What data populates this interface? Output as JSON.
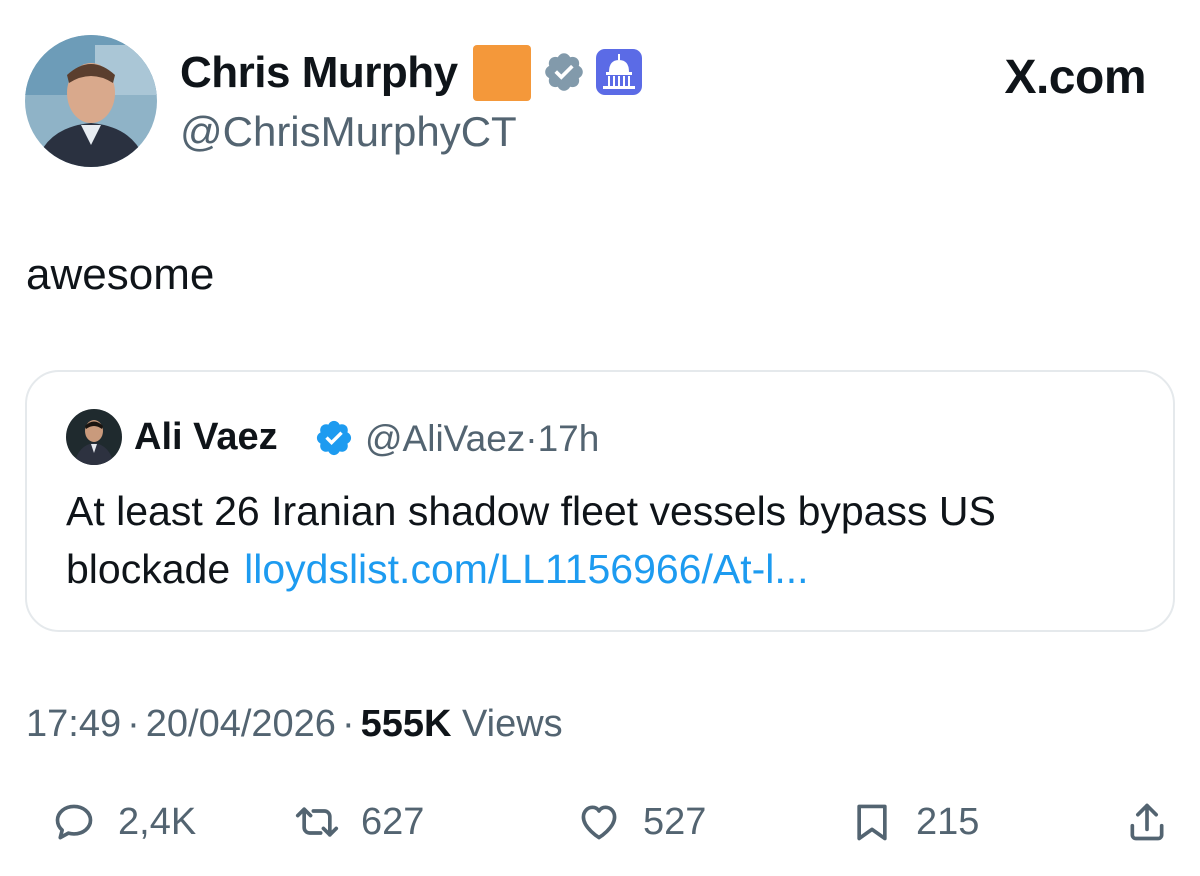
{
  "header": {
    "author_name": "Chris Murphy",
    "author_handle": "@ChrisMurphyCT",
    "site_label": "X.com",
    "emoji_badge_color": "#f4983a"
  },
  "tweet": {
    "text": "awesome"
  },
  "quote": {
    "author_name": "Ali Vaez",
    "author_handle": "@AliVaez",
    "time_sep": "·",
    "time_ago": "17h",
    "text_line1": "At least 26 Iranian shadow fleet vessels bypass US",
    "text_line2": "blockade",
    "link": "lloydslist.com/LL1156966/At-l..."
  },
  "meta": {
    "time": "17:49",
    "date": "20/04/2026",
    "sep": "·",
    "views_count": "555K",
    "views_label": "Views"
  },
  "actions": {
    "replies": "2,4K",
    "reposts": "627",
    "likes": "527",
    "bookmarks": "215"
  },
  "colors": {
    "link": "#1d9bf0",
    "secondary_text": "#536471",
    "verified_blue": "#1d9bf0",
    "verified_grey": "#829aab",
    "capitol_badge": "#5b6be6"
  },
  "icons": [
    "verified-grey-icon",
    "capitol-badge-icon",
    "verified-blue-icon",
    "reply-icon",
    "repost-icon",
    "like-icon",
    "bookmark-icon",
    "share-icon"
  ]
}
